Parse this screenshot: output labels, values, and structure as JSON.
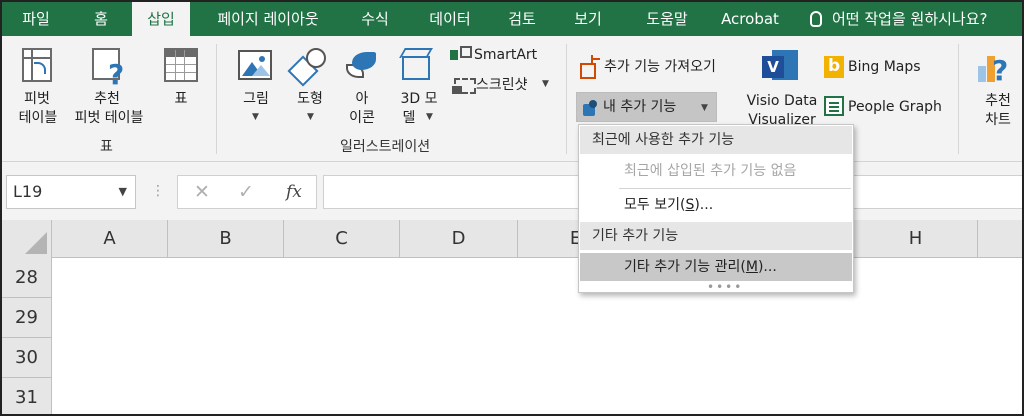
{
  "tabs": [
    {
      "label": "파일",
      "active": false
    },
    {
      "label": "홈",
      "active": false
    },
    {
      "label": "삽입",
      "active": true
    },
    {
      "label": "페이지 레이아웃",
      "active": false
    },
    {
      "label": "수식",
      "active": false
    },
    {
      "label": "데이터",
      "active": false
    },
    {
      "label": "검토",
      "active": false
    },
    {
      "label": "보기",
      "active": false
    },
    {
      "label": "도움말",
      "active": false
    },
    {
      "label": "Acrobat",
      "active": false
    }
  ],
  "tell_me": "어떤 작업을 원하시나요?",
  "ribbon": {
    "pivot_table": {
      "line1": "피벗",
      "line2": "테이블"
    },
    "recommended_pivot": {
      "line1": "추천",
      "line2": "피벗 테이블"
    },
    "table": {
      "label": "표"
    },
    "tables_group": "표",
    "picture": {
      "label": "그림"
    },
    "shapes": {
      "label": "도형"
    },
    "icons": {
      "line1": "아",
      "line2": "이콘"
    },
    "model_3d": {
      "line1": "3D 모",
      "line2": "델"
    },
    "smartart": {
      "label": "SmartArt"
    },
    "screenshot": {
      "label": "스크린샷"
    },
    "illustrations_group": "일러스트레이션",
    "get_addins": {
      "label": "추가 기능 가져오기"
    },
    "my_addins": {
      "label": "내 추가 기능"
    },
    "visio": {
      "line1": "Visio Data",
      "line2": "Visualizer"
    },
    "bing_maps": {
      "label": "Bing Maps"
    },
    "people_graph": {
      "label": "People Graph"
    },
    "recommended_charts": {
      "line1": "추천",
      "line2": "차트"
    }
  },
  "formula_bar": {
    "name_box": "L19",
    "fx": "fx",
    "formula": ""
  },
  "grid": {
    "columns": [
      "A",
      "B",
      "C",
      "D",
      "E",
      "",
      "",
      "H"
    ],
    "rows": [
      "28",
      "29",
      "30",
      "31"
    ]
  },
  "dropdown": {
    "recent_header": "최근에 사용한 추가 기능",
    "no_recent": "최근에 삽입된 추가 기능 없음",
    "see_all_prefix": "모두 보기(",
    "see_all_key": "S",
    "see_all_suffix": ")...",
    "other_header": "기타 추가 기능",
    "manage_prefix": "기타 추가 기능 관리(",
    "manage_key": "M",
    "manage_suffix": ")..."
  },
  "colors": {
    "brand_green": "#217346",
    "ribbon_bg": "#f3f3f3",
    "accent_blue": "#2e75b6"
  }
}
